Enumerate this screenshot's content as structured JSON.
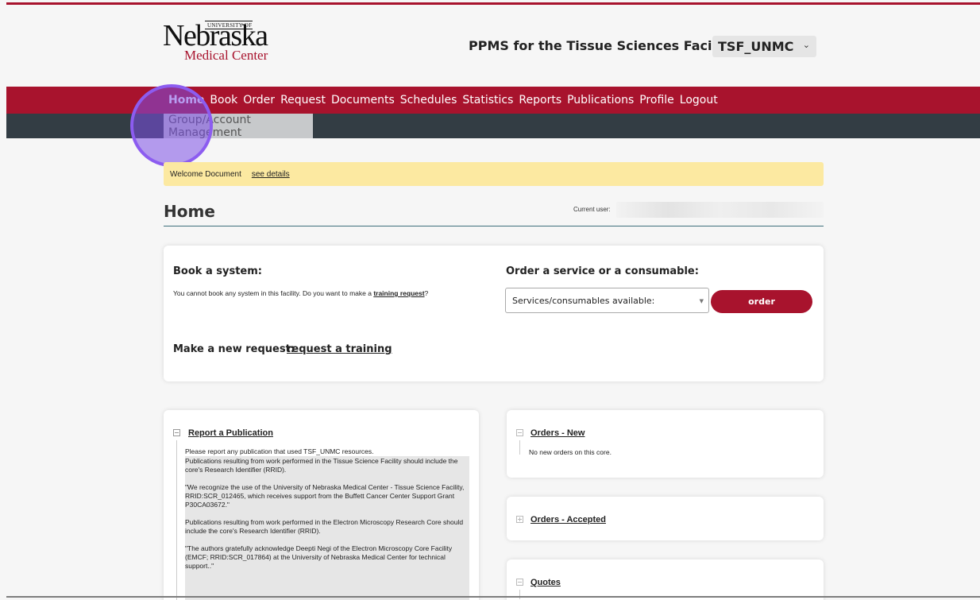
{
  "header": {
    "logo": {
      "university_of": "UNIVERSITY OF",
      "name": "Nebraska",
      "subtitle": "Medical Center"
    },
    "facility_title": "PPMS for the Tissue Sciences Facility -",
    "facility_select": "TSF_UNMC"
  },
  "nav": {
    "main": [
      "Home",
      "Book",
      "Order",
      "Request",
      "Documents",
      "Schedules",
      "Statistics",
      "Reports",
      "Publications",
      "Profile",
      "Logout"
    ],
    "sub": "Group/Account Management"
  },
  "welcome": {
    "label": "Welcome Document",
    "link": "see details"
  },
  "home": {
    "title": "Home",
    "current_user_label": "Current user:"
  },
  "book": {
    "heading": "Book a system:",
    "text": "You cannot book any system in this facility. Do you want to make a ",
    "link": "training request",
    "suffix": "?"
  },
  "order": {
    "heading": "Order a service or a consumable:",
    "select": "Services/consumables available:",
    "button": "order"
  },
  "request": {
    "label": "Make a new request:",
    "link": "request a training"
  },
  "publication": {
    "heading": "Report a Publication",
    "intro": "Please report any publication that used TSF_UNMC resources.",
    "paragraphs": [
      "Publications resulting from work performed in the Tissue Science Facility should include the core's Research Identifier (RRID).",
      "\"We recognize the use of the University of Nebraska Medical Center - Tissue Science Facility, RRID:SCR_012465, which receives support from the Buffett Cancer Center Support Grant P30CA03672.\"",
      "Publications resulting from work performed in the Electron Microscopy Research Core should include the core's Research Identifier (RRID).",
      "\"The authors gratefully acknowledge Deepti Negi of the Electron Microscopy Core Facility (EMCF; RRID:SCR_017864) at the University of Nebraska Medical Center for technical support..\""
    ]
  },
  "orders_new": {
    "heading": "Orders - New",
    "text": "No new orders on this core."
  },
  "orders_accepted": {
    "heading": "Orders - Accepted"
  },
  "quotes": {
    "heading": "Quotes"
  },
  "colors": {
    "brand_red": "#a8132d",
    "subnav": "#333d44",
    "welcome_bg": "#fce9a1",
    "click_marker": "#8c5cf0"
  }
}
